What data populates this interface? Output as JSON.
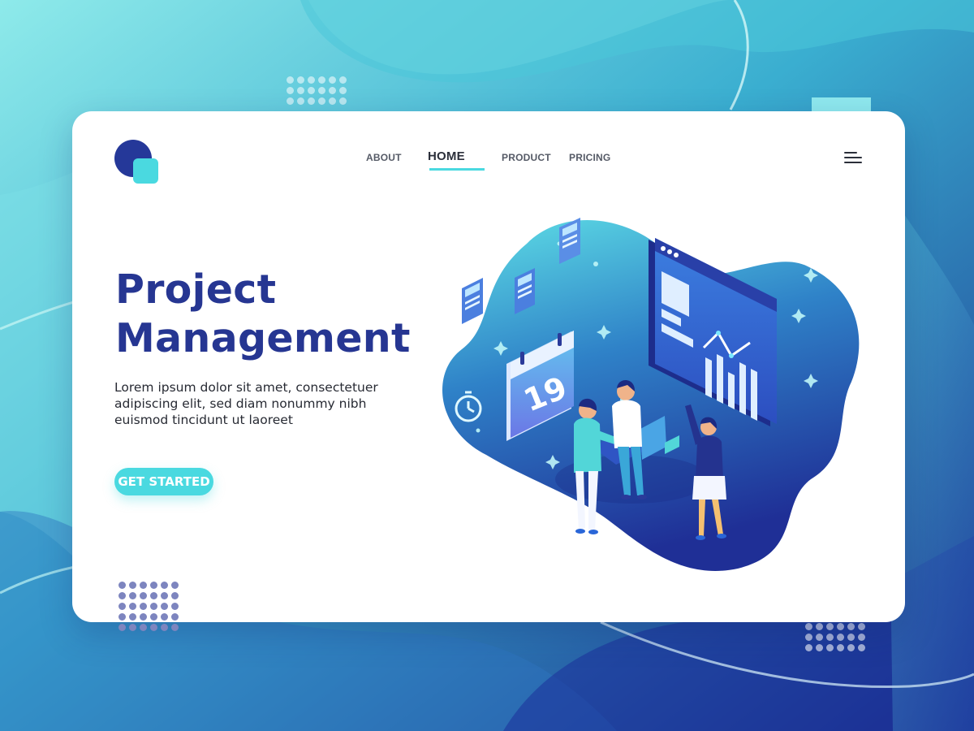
{
  "nav": {
    "items": [
      {
        "label": "ABOUT"
      },
      {
        "label": "HOME",
        "active": true
      },
      {
        "label": "PRODUCT"
      },
      {
        "label": "PRICING"
      }
    ]
  },
  "hero": {
    "title_line1": "Project",
    "title_line2": "Management",
    "body": "Lorem ipsum dolor sit amet, consectetuer adipiscing elit, sed diam nonummy nibh euismod tincidunt ut laoreet",
    "cta_label": "GET STARTED"
  },
  "illustration": {
    "calendar_day": "19"
  },
  "icons": {
    "logo": "logo-icon",
    "menu": "hamburger-menu-icon",
    "stopwatch": "stopwatch-icon",
    "calendar": "calendar-icon"
  },
  "colors": {
    "brand_navy": "#263692",
    "accent_teal": "#4ad9e0",
    "text_dark": "#272a33"
  }
}
